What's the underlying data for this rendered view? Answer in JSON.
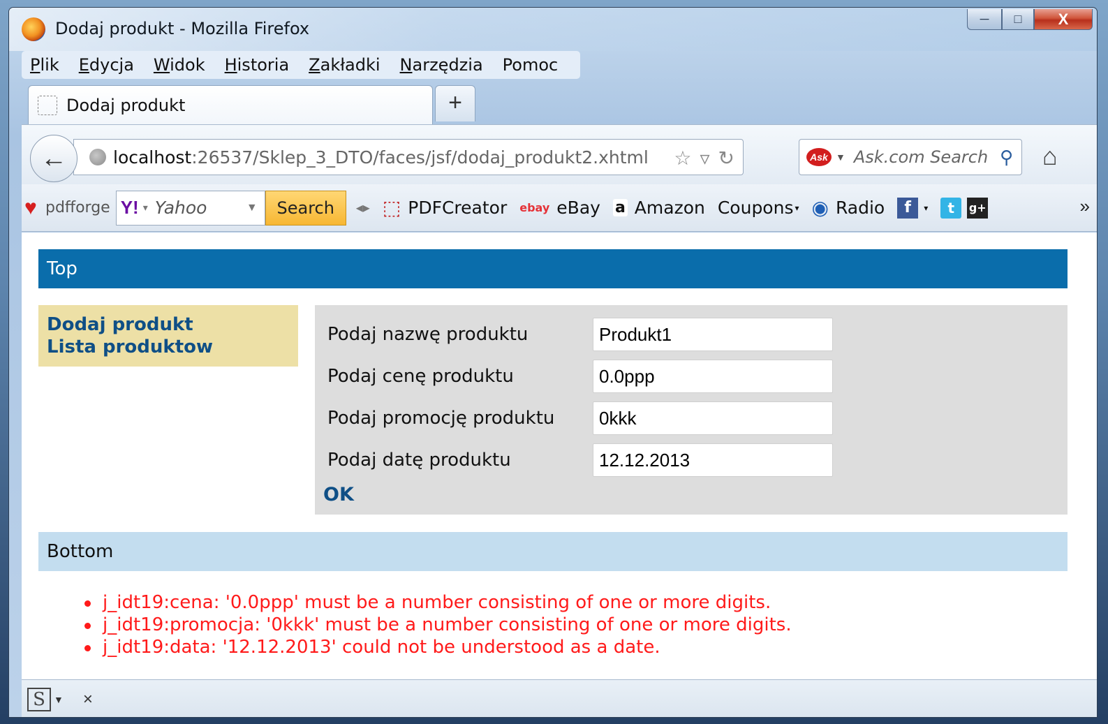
{
  "window": {
    "title": "Dodaj produkt - Mozilla Firefox",
    "minimize": "─",
    "maximize": "□",
    "close": "X"
  },
  "menu": {
    "items": [
      {
        "mnemonic": "P",
        "rest": "lik"
      },
      {
        "mnemonic": "E",
        "rest": "dycja"
      },
      {
        "mnemonic": "W",
        "rest": "idok"
      },
      {
        "mnemonic": "H",
        "rest": "istoria"
      },
      {
        "mnemonic": "Z",
        "rest": "akładki"
      },
      {
        "mnemonic": "N",
        "rest": "arzędzia"
      },
      {
        "mnemonic": "",
        "rest": "Pomoc"
      }
    ]
  },
  "tab": {
    "label": "Dodaj produkt",
    "new_tab": "+"
  },
  "navbar": {
    "url_host": "localhost",
    "url_path": ":26537/Sklep_3_DTO/faces/jsf/dodaj_produkt2.xhtml",
    "search_placeholder": "Ask.com Search",
    "ask_logo": "Ask"
  },
  "bookmarks": {
    "pdfforge": "pdfforge",
    "yahoo_logo": "Y!",
    "yahoo_text": "Yahoo",
    "search_button": "Search",
    "items": [
      {
        "icon": "pdf-icon",
        "glyph": "⬚",
        "label": "PDFCreator"
      },
      {
        "icon": "ebay-icon",
        "glyph": "ebay",
        "label": "eBay"
      },
      {
        "icon": "amazon-icon",
        "glyph": "a",
        "label": "Amazon"
      },
      {
        "icon": "",
        "glyph": "",
        "label": "Coupons"
      },
      {
        "icon": "radio-icon",
        "glyph": "◉",
        "label": "Radio"
      }
    ],
    "facebook_glyph": "f",
    "twitter_glyph": "t",
    "gplus_glyph": "g+",
    "more": "»"
  },
  "page": {
    "top_label": "Top",
    "menu_links": [
      "Dodaj produkt",
      "Lista produktow"
    ],
    "form": {
      "fields": [
        {
          "label": "Podaj nazwę produktu",
          "value": "Produkt1"
        },
        {
          "label": "Podaj cenę produktu",
          "value": "0.0ppp"
        },
        {
          "label": "Podaj promocję produktu",
          "value": "0kkk"
        },
        {
          "label": "Podaj datę produktu",
          "value": "12.12.2013"
        }
      ],
      "submit": "OK"
    },
    "bottom_label": "Bottom",
    "errors": [
      "j_idt19:cena: '0.0ppp' must be a number consisting of one or more digits.",
      "j_idt19:promocja: '0kkk' must be a number consisting of one or more digits.",
      "j_idt19:data: '12.12.2013' could not be understood as a date."
    ]
  },
  "statusbar": {
    "addon_glyph": "S",
    "close": "×"
  },
  "colors": {
    "top_bar": "#0a6dab",
    "bottom_bar": "#c3ddef",
    "menu_bg": "#ede0a6",
    "form_bg": "#dddddd",
    "error": "#ff1a1a",
    "link": "#0f4f86"
  }
}
